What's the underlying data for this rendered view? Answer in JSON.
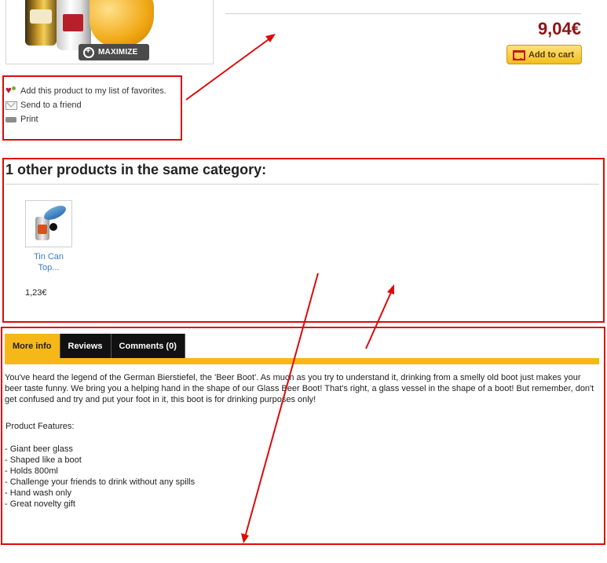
{
  "product_image": {
    "zoom_label": "MAXIMIZE"
  },
  "price": "9,04€",
  "add_to_cart_label": "Add to cart",
  "actions": [
    {
      "label": "Add this product to my list of favorites.",
      "icon": "heart-icon"
    },
    {
      "label": "Send to a friend",
      "icon": "mail-icon"
    },
    {
      "label": "Print",
      "icon": "print-icon"
    }
  ],
  "category": {
    "title": "1 other products in the same category:",
    "items": [
      {
        "name": "Tin Can Top...",
        "price": "1,23€"
      }
    ]
  },
  "tabs": [
    {
      "label": "More info",
      "active": true
    },
    {
      "label": "Reviews",
      "active": false
    },
    {
      "label": "Comments (0)",
      "active": false
    }
  ],
  "description": "You've heard the legend of the German Bierstiefel, the 'Beer Boot'. As much as you try to understand it, drinking from a smelly old boot just makes your beer taste funny. We bring you a helping hand in the shape of our Glass Beer Boot! That's right, a glass vessel in the shape of a boot! But remember, don't get confused and try and put your foot in it, this boot is for drinking purposes only!",
  "features_title": "Product Features:",
  "features": [
    "- Giant beer glass",
    "- Shaped like a boot",
    "- Holds 800ml",
    "- Challenge your friends to drink without any spills",
    "- Hand wash only",
    "- Great novelty gift"
  ],
  "colors": {
    "annotation_red": "#dd0a0a",
    "accent_yellow": "#f6b719",
    "price_red": "#8c1515",
    "link_blue": "#3b7dc4"
  }
}
